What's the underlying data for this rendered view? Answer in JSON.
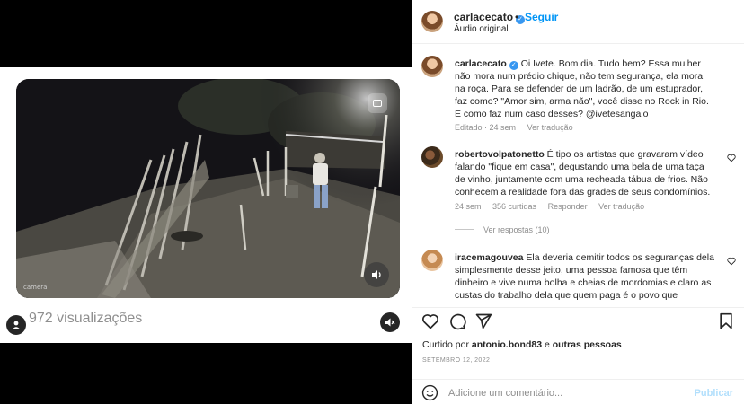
{
  "media": {
    "camera_label": "camera",
    "views": "972 visualizações"
  },
  "post": {
    "username": "carlacecato",
    "follow": "Seguir",
    "dot": "•",
    "audio": "Áudio original"
  },
  "caption": {
    "username": "carlacecato",
    "text": "Oi Ivete. Bom dia. Tudo bem? Essa mulher não mora num prédio chique, não tem segurança, ela mora na roça. Para se defender de um ladrão, de um estuprador, faz como? \"Amor sim, arma não\", você disse no Rock in Rio. E como faz num caso desses? @ivetesangalo",
    "edited": "Editado · 24 sem",
    "see_translation": "Ver tradução"
  },
  "comments": [
    {
      "username": "robertovolpatonetto",
      "text": "É tipo os artistas que gravaram vídeo falando \"fique em casa\", degustando uma bela de uma taça de vinho, juntamente com uma recheada tábua de frios. Não conhecem a realidade fora das grades de seus condomínios.",
      "age": "24 sem",
      "likes": "356 curtidas",
      "reply": "Responder",
      "translate": "Ver tradução",
      "replies": "Ver respostas (10)"
    },
    {
      "username": "iracemagouvea",
      "text": "Ela deveria demitir todos os seguranças dela simplesmente desse jeito, uma pessoa famosa que têm dinheiro e vive numa bolha e cheias de mordomias e claro as custas do trabalho dela que quem paga é o povo que"
    }
  ],
  "footer": {
    "liked_prefix": "Curtido por",
    "liked_user": "antonio.bond83",
    "liked_and": "e",
    "liked_others": "outras pessoas",
    "date": "SETEMBRO 12, 2022",
    "comment_placeholder": "Adicione um comentário...",
    "publish": "Publicar"
  },
  "colors": {
    "accent": "#0095f6",
    "verified": "#3897f0",
    "muted_text": "#8e8e8e"
  }
}
